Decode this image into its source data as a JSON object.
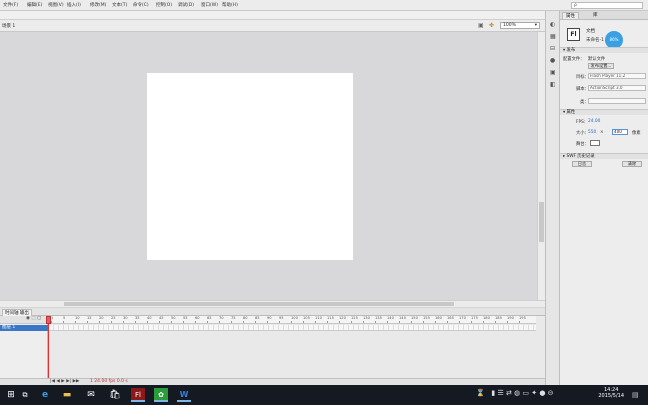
{
  "menu": {
    "items": [
      "文件(F)",
      "编辑(E)",
      "视图(V)",
      "插入(I)",
      "修改(M)",
      "文本(T)",
      "命令(C)",
      "控制(O)",
      "调试(D)",
      "窗口(W)",
      "帮助(H)"
    ],
    "search_placeholder": "ρ"
  },
  "editbar": {
    "scene_label": "场景 1",
    "zoom_value": "100%",
    "zoom_caret": "▾",
    "edit_scene_icon": "▣",
    "edit_symbol_icon": "✤"
  },
  "timeline": {
    "tab_label": "时间轴 输出",
    "layer_name": "图层 1",
    "header_icons": "◉ ⬚ ▢",
    "ruler_labels": [
      "1",
      "5",
      "10",
      "15",
      "20",
      "25",
      "30",
      "35",
      "40",
      "45",
      "50",
      "55",
      "60",
      "65",
      "70",
      "75",
      "80",
      "85",
      "90",
      "95",
      "100",
      "105",
      "110",
      "115",
      "120",
      "125",
      "130",
      "135",
      "140",
      "145",
      "150",
      "155",
      "160",
      "165",
      "170",
      "175",
      "180",
      "185",
      "190",
      "195"
    ],
    "footer_controls": "|◀ ◀ ▶ ▶| ▶▶",
    "footer_status": "1  24.00 fps  0.0 s"
  },
  "properties": {
    "tabs": [
      "属性",
      "库"
    ],
    "doc_type_icon": "Fl",
    "doc_label": "文档",
    "doc_name": "未命名-1",
    "badge": "86%",
    "section_publish": "▾ 发布",
    "profile_label": "配置文件：",
    "profile_value": "默认文件",
    "publish_settings_button": "发布设置...",
    "target_label": "目标：",
    "target_value": "Flash Player 11.2",
    "script_label": "脚本：",
    "script_value": "ActionScript 3.0",
    "class_label": "类：",
    "section_properties": "▾ 属性",
    "fps_label": "FPS：",
    "fps_value": "24.00",
    "size_label": "大小：",
    "size_width": "550",
    "size_x": "×",
    "size_height": "400",
    "size_unit": "像素",
    "stage_label": "舞台：",
    "section_swf": "▸ SWF 历史记录",
    "log_button": "日志",
    "clear_button": "清除"
  },
  "taskbar": {
    "time": "14:24",
    "date": "2015/5/14",
    "icons": [
      "windows-logo",
      "task-view",
      "edge",
      "file-explorer",
      "mail",
      "store",
      "flash",
      "green-app",
      "word"
    ]
  }
}
